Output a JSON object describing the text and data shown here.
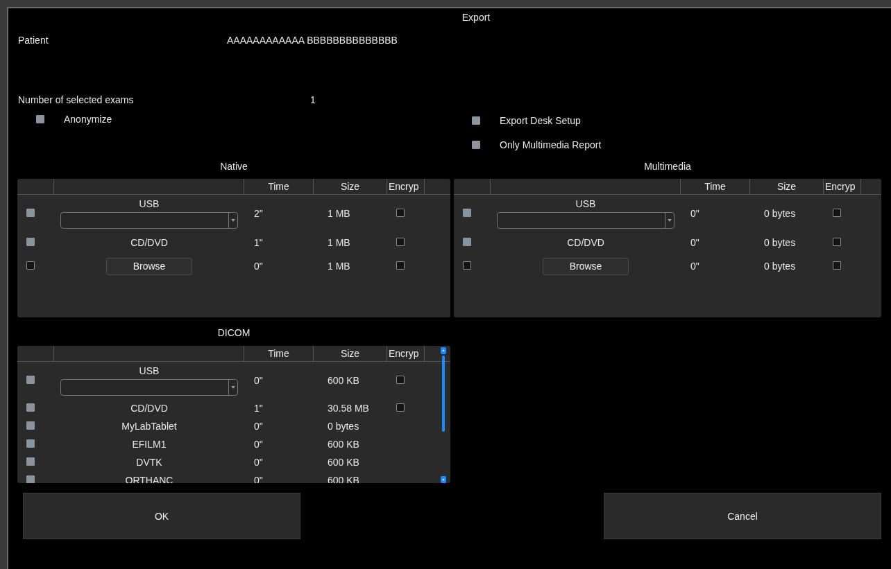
{
  "window": {
    "title": "Export"
  },
  "patient": {
    "label": "Patient",
    "value": "AAAAAAAAAAAA BBBBBBBBBBBBBB"
  },
  "exam_count": {
    "label": "Number of selected exams",
    "value": "1"
  },
  "options_left": [
    {
      "label": "Anonymize",
      "checked": true
    }
  ],
  "options_right": [
    {
      "label": "Export Desk Setup",
      "checked": true
    },
    {
      "label": "Only Multimedia Report",
      "checked": true
    }
  ],
  "tables": [
    {
      "title": "Native",
      "scrollbar": false,
      "columns": [
        "Time",
        "Size",
        "Encryp"
      ],
      "rows": [
        {
          "kind": "dropdown",
          "label": "USB",
          "checked": true,
          "time": "2\"",
          "size": "1 MB",
          "encrypt": false
        },
        {
          "kind": "text",
          "label": "CD/DVD",
          "checked": true,
          "time": "1\"",
          "size": "1 MB",
          "encrypt": false
        },
        {
          "kind": "button",
          "label": "Browse",
          "checked": false,
          "time": "0\"",
          "size": "1 MB",
          "encrypt": false
        }
      ]
    },
    {
      "title": "Multimedia",
      "scrollbar": false,
      "columns": [
        "Time",
        "Size",
        "Encryp"
      ],
      "rows": [
        {
          "kind": "dropdown",
          "label": "USB",
          "checked": true,
          "time": "0\"",
          "size": "0 bytes",
          "encrypt": false
        },
        {
          "kind": "text",
          "label": "CD/DVD",
          "checked": true,
          "time": "0\"",
          "size": "0 bytes",
          "encrypt": false
        },
        {
          "kind": "button",
          "label": "Browse",
          "checked": false,
          "time": "0\"",
          "size": "0 bytes",
          "encrypt": false
        }
      ]
    },
    {
      "title": "DICOM",
      "scrollbar": true,
      "columns": [
        "Time",
        "Size",
        "Encryp"
      ],
      "rows": [
        {
          "kind": "dropdown",
          "label": "USB",
          "checked": true,
          "time": "0\"",
          "size": "600 KB",
          "encrypt": false
        },
        {
          "kind": "text",
          "label": "CD/DVD",
          "checked": true,
          "time": "1\"",
          "size": "30.58 MB",
          "encrypt": false
        },
        {
          "kind": "text",
          "label": "MyLabTablet",
          "checked": true,
          "time": "0\"",
          "size": "0 bytes"
        },
        {
          "kind": "text",
          "label": "EFILM1",
          "checked": true,
          "time": "0\"",
          "size": "600 KB"
        },
        {
          "kind": "text",
          "label": "DVTK",
          "checked": true,
          "time": "0\"",
          "size": "600 KB"
        },
        {
          "kind": "text",
          "label": "ORTHANC",
          "checked": true,
          "time": "0\"",
          "size": "600 KB"
        }
      ]
    }
  ],
  "buttons": [
    "OK",
    "Cancel"
  ]
}
